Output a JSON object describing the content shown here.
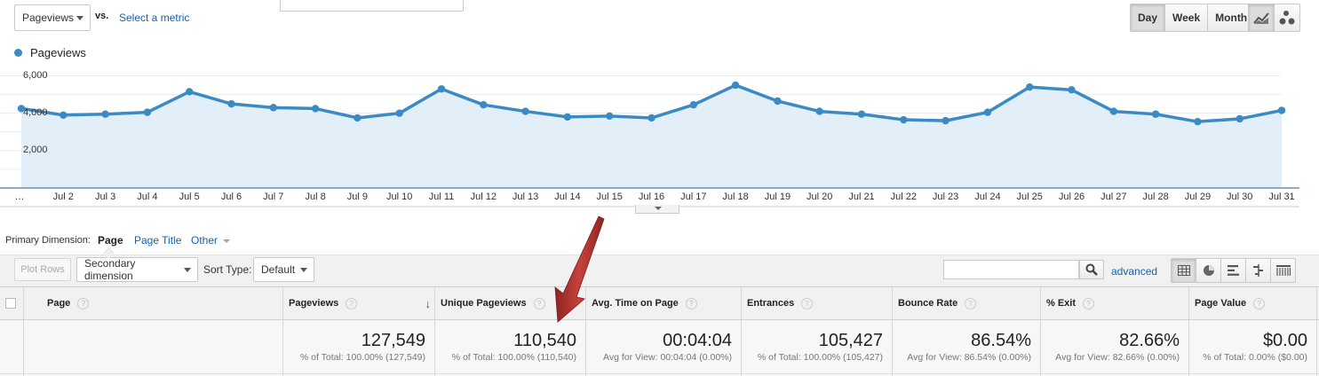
{
  "metric_picker": {
    "selected": "Pageviews",
    "vs_label": "vs.",
    "select_metric_link": "Select a metric"
  },
  "time_buttons": [
    "Day",
    "Week",
    "Month"
  ],
  "time_active": "Day",
  "legend": {
    "series_name": "Pageviews",
    "color": "#3b8ac4"
  },
  "chart_data": {
    "type": "area",
    "x": [
      "…",
      "Jul 2",
      "Jul 3",
      "Jul 4",
      "Jul 5",
      "Jul 6",
      "Jul 7",
      "Jul 8",
      "Jul 9",
      "Jul 10",
      "Jul 11",
      "Jul 12",
      "Jul 13",
      "Jul 14",
      "Jul 15",
      "Jul 16",
      "Jul 17",
      "Jul 18",
      "Jul 19",
      "Jul 20",
      "Jul 21",
      "Jul 22",
      "Jul 23",
      "Jul 24",
      "Jul 25",
      "Jul 26",
      "Jul 27",
      "Jul 28",
      "Jul 29",
      "Jul 30",
      "Jul 31"
    ],
    "series": [
      {
        "name": "Pageviews",
        "values": [
          4250,
          3900,
          3950,
          4050,
          5150,
          4500,
          4300,
          4250,
          3750,
          4000,
          5300,
          4450,
          4100,
          3800,
          3850,
          3750,
          4450,
          5500,
          4650,
          4100,
          3950,
          3650,
          3600,
          4050,
          5400,
          5250,
          4100,
          3950,
          3550,
          3700,
          4150
        ]
      }
    ],
    "yticks": [
      "6,000",
      "4,000",
      "2,000"
    ],
    "ytick_values": [
      6000,
      4000,
      2000
    ],
    "ylim": [
      0,
      6000
    ],
    "grid": true,
    "legend": "top-left",
    "color": "#3b8ac4",
    "fill": "#e3eff8"
  },
  "dimension": {
    "label": "Primary Dimension:",
    "active": "Page",
    "other1": "Page Title",
    "other2": "Other"
  },
  "toolbar": {
    "plot_rows": "Plot Rows",
    "secondary": "Secondary dimension",
    "sort_label": "Sort Type:",
    "sort_value": "Default",
    "advanced": "advanced"
  },
  "columns": [
    {
      "name": "Page"
    },
    {
      "name": "Pageviews",
      "total": "127,549",
      "sub": "% of Total: 100.00% (127,549)"
    },
    {
      "name": "Unique Pageviews",
      "total": "110,540",
      "sub": "% of Total: 100.00% (110,540)"
    },
    {
      "name": "Avg. Time on Page",
      "total": "00:04:04",
      "sub": "Avg for View: 00:04:04 (0.00%)"
    },
    {
      "name": "Entrances",
      "total": "105,427",
      "sub": "% of Total: 100.00% (105,427)"
    },
    {
      "name": "Bounce Rate",
      "total": "86.54%",
      "sub": "Avg for View: 86.54% (0.00%)"
    },
    {
      "name": "% Exit",
      "total": "82.66%",
      "sub": "Avg for View: 82.66% (0.00%)"
    },
    {
      "name": "Page Value",
      "total": "$0.00",
      "sub": "% of Total: 0.00% ($0.00)"
    }
  ],
  "help_glyph": "?",
  "sort_arrow_glyph": "↓",
  "annotation": {
    "color": "#b93a36"
  }
}
